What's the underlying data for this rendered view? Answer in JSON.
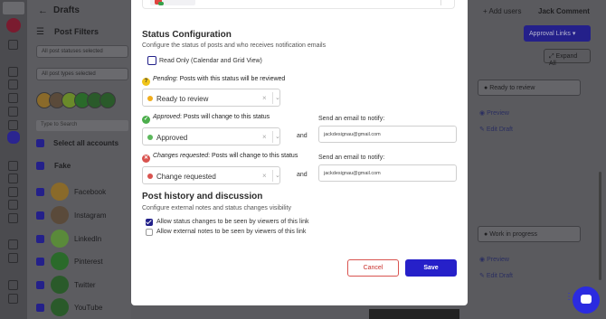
{
  "app": {
    "page_title": "Drafts",
    "post_filters_label": "Post Filters",
    "post_statuses_placeholder": "All post statuses selected",
    "post_types_placeholder": "All post types selected",
    "search_placeholder": "Type to Search",
    "select_all_label": "Select all accounts",
    "group_label": "Fake",
    "accounts": [
      {
        "name": "Facebook",
        "color": "#9a6a2a"
      },
      {
        "name": "Instagram",
        "color": "#6a3a2a"
      },
      {
        "name": "LinkedIn",
        "color": "#4a7a2a"
      },
      {
        "name": "Pinterest",
        "color": "#2a5a2a"
      },
      {
        "name": "Twitter",
        "color": "#2a5a2a"
      },
      {
        "name": "YouTube",
        "color": "#2a5a2a"
      }
    ],
    "add_users": "+ Add users",
    "user_name": "Jack Comment",
    "approval_links": "Approval Links",
    "expand_all": "Expand All",
    "bg_status_1": "Ready to review",
    "bg_status_2": "Work in progress",
    "preview": "Preview",
    "edit_draft": "Edit Draft"
  },
  "modal": {
    "status_config_title": "Status Configuration",
    "status_config_sub": "Configure the status of posts and who receives notification emails",
    "read_only_label": "Read Only (Calendar and Grid View)",
    "read_only_checked": false,
    "pending": {
      "label_em": "Pending",
      "label_rest": ": Posts with this status will be reviewed",
      "value": "Ready to review",
      "dot_color": "#f0ad1c",
      "icon_color": "#f0c419",
      "icon_glyph": "?"
    },
    "approved": {
      "label_em": "Approved",
      "label_rest": ": Posts will change to this status",
      "value": "Approved",
      "dot_color": "#5cb85c",
      "icon_color": "#4cae4c",
      "icon_glyph": "✓",
      "and": "and",
      "notify_label": "Send an email to notify:",
      "email": "jackdesignau@gmail.com"
    },
    "changes": {
      "label_em": "Changes requested",
      "label_rest": ": Posts will change to this status",
      "value": "Change requested",
      "dot_color": "#d9534f",
      "icon_color": "#d9534f",
      "icon_glyph": "✕",
      "and": "and",
      "notify_label": "Send an email to notify:",
      "email": "jackdesignau@gmail.com"
    },
    "history_title": "Post history and discussion",
    "history_sub": "Configure external notes and status changes visibility",
    "allow_status_label": "Allow status changes to be seen by viewers of this link",
    "allow_status_checked": true,
    "allow_notes_label": "Allow external notes to be seen by viewers of this link",
    "allow_notes_checked": false,
    "cancel_label": "Cancel",
    "save_label": "Save"
  }
}
